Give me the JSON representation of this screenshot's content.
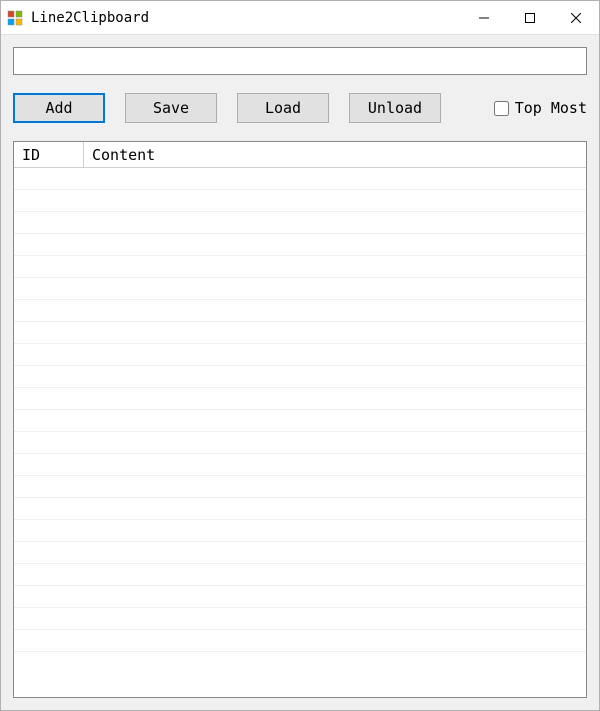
{
  "window": {
    "title": "Line2Clipboard"
  },
  "input": {
    "value": "",
    "placeholder": ""
  },
  "buttons": {
    "add": "Add",
    "save": "Save",
    "load": "Load",
    "unload": "Unload"
  },
  "checkbox": {
    "topmost_label": "Top Most",
    "topmost_checked": false
  },
  "listview": {
    "columns": {
      "id": "ID",
      "content": "Content"
    },
    "rows": []
  }
}
